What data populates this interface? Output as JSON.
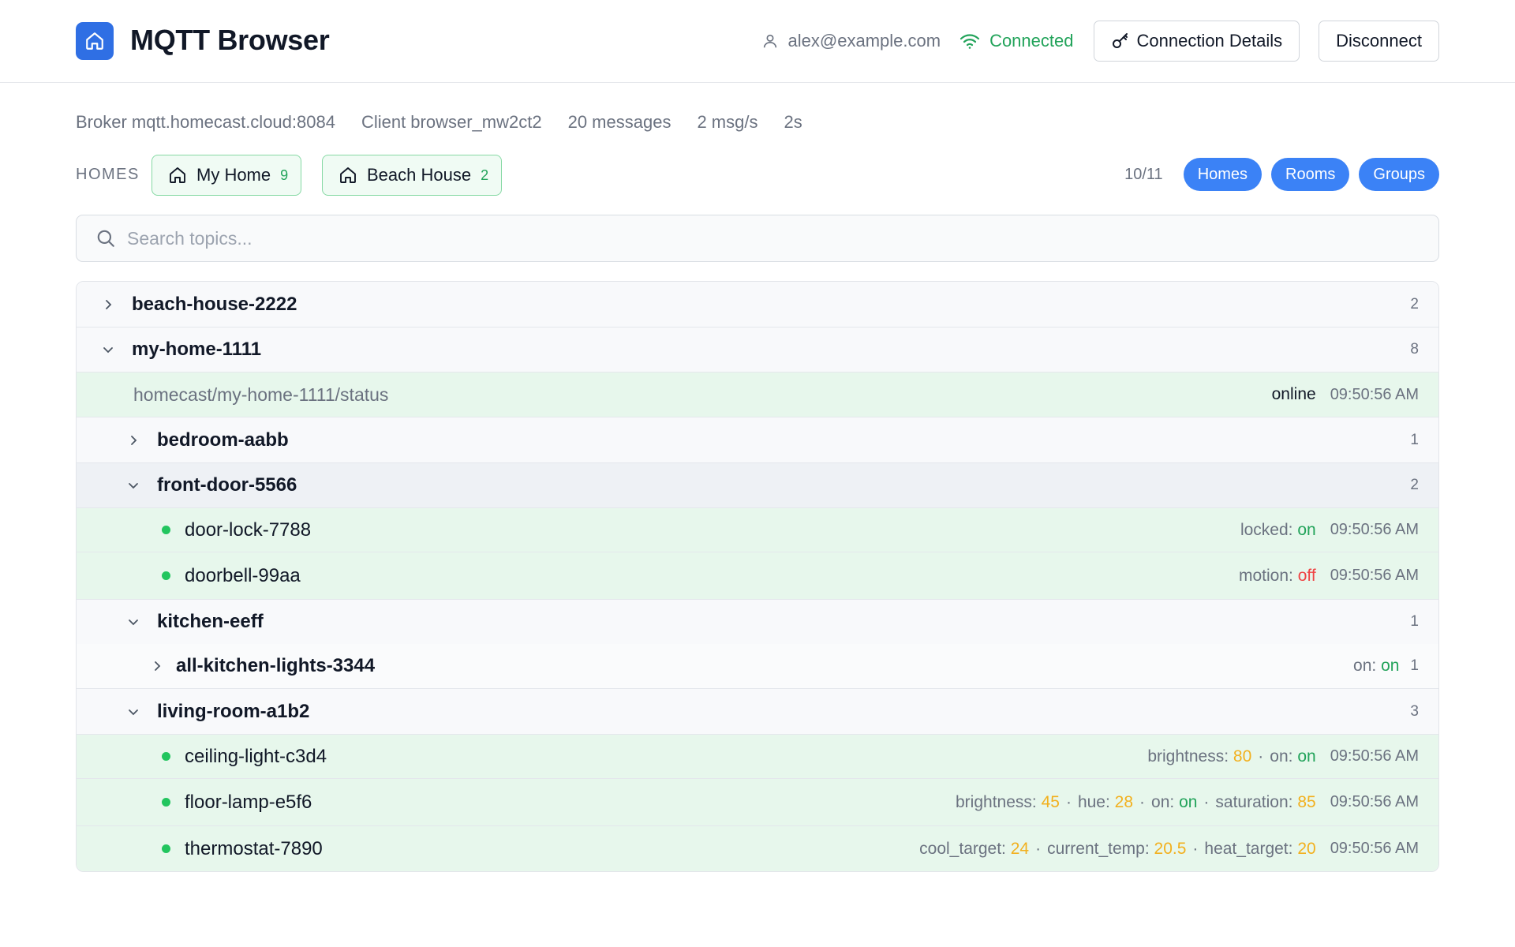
{
  "header": {
    "app_title": "MQTT Browser",
    "logo_icon": "home-icon",
    "user_email": "alex@example.com",
    "status": "Connected",
    "connection_details_label": "Connection Details",
    "disconnect_label": "Disconnect"
  },
  "stats": {
    "broker": "Broker mqtt.homecast.cloud:8084",
    "client": "Client browser_mw2ct2",
    "messages": "20 messages",
    "rate": "2 msg/s",
    "age": "2s"
  },
  "homes": {
    "label": "HOMES",
    "chips": [
      {
        "name": "My Home",
        "count": "9"
      },
      {
        "name": "Beach House",
        "count": "2"
      }
    ],
    "visible_count": "10/11",
    "filters": [
      "Homes",
      "Rooms",
      "Groups"
    ]
  },
  "search": {
    "placeholder": "Search topics..."
  },
  "tree": {
    "beach_house": {
      "name": "beach-house-2222",
      "count": "2"
    },
    "my_home": {
      "name": "my-home-1111",
      "count": "8",
      "status_topic": "homecast/my-home-1111/status",
      "status_value": "online",
      "status_time": "09:50:56 AM"
    },
    "bedroom": {
      "name": "bedroom-aabb",
      "count": "1"
    },
    "front_door": {
      "name": "front-door-5566",
      "count": "2",
      "door_lock": {
        "name": "door-lock-7788",
        "key": "locked:",
        "value": "on",
        "time": "09:50:56 AM"
      },
      "doorbell": {
        "name": "doorbell-99aa",
        "key": "motion:",
        "value": "off",
        "time": "09:50:56 AM"
      }
    },
    "kitchen": {
      "name": "kitchen-eeff",
      "count": "1",
      "all_lights": {
        "name": "all-kitchen-lights-3344",
        "key": "on:",
        "value": "on",
        "count": "1"
      }
    },
    "living_room": {
      "name": "living-room-a1b2",
      "count": "3",
      "ceiling_light": {
        "name": "ceiling-light-c3d4",
        "brightness_key": "brightness:",
        "brightness": "80",
        "on_key": "on:",
        "on": "on",
        "time": "09:50:56 AM"
      },
      "floor_lamp": {
        "name": "floor-lamp-e5f6",
        "brightness_key": "brightness:",
        "brightness": "45",
        "hue_key": "hue:",
        "hue": "28",
        "on_key": "on:",
        "on": "on",
        "saturation_key": "saturation:",
        "saturation": "85",
        "time": "09:50:56 AM"
      },
      "thermostat": {
        "name": "thermostat-7890",
        "cool_key": "cool_target:",
        "cool": "24",
        "current_key": "current_temp:",
        "current": "20.5",
        "heat_key": "heat_target:",
        "heat": "20",
        "time": "09:50:56 AM"
      }
    },
    "separator": "·"
  }
}
